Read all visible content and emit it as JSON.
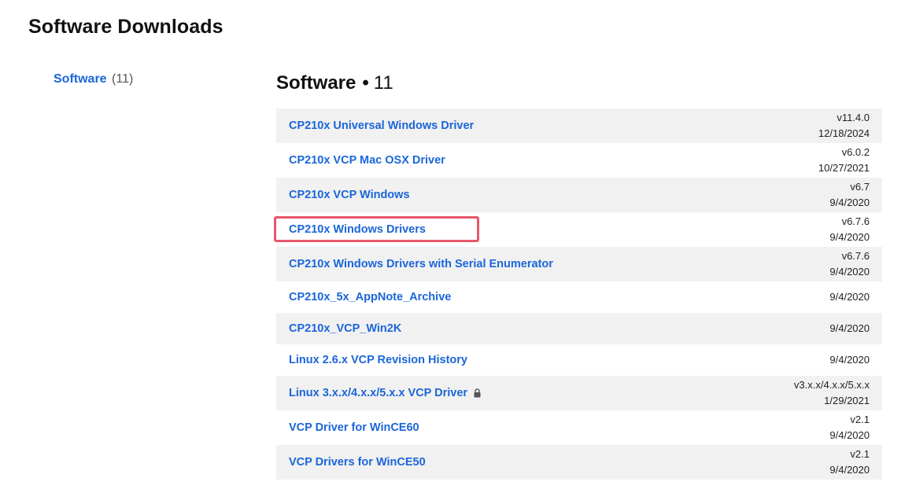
{
  "page": {
    "title": "Software Downloads"
  },
  "sidebar": {
    "items": [
      {
        "label": "Software",
        "count": "(11)"
      }
    ]
  },
  "section": {
    "name": "Software",
    "separator": "•",
    "count": "11"
  },
  "downloads": [
    {
      "name": "CP210x Universal Windows Driver",
      "version": "v11.4.0",
      "date": "12/18/2024",
      "locked": false
    },
    {
      "name": "CP210x VCP Mac OSX Driver",
      "version": "v6.0.2",
      "date": "10/27/2021",
      "locked": false
    },
    {
      "name": "CP210x VCP Windows",
      "version": "v6.7",
      "date": "9/4/2020",
      "locked": false
    },
    {
      "name": "CP210x Windows Drivers",
      "version": "v6.7.6",
      "date": "9/4/2020",
      "locked": false,
      "highlighted": true
    },
    {
      "name": "CP210x Windows Drivers with Serial Enumerator",
      "version": "v6.7.6",
      "date": "9/4/2020",
      "locked": false
    },
    {
      "name": "CP210x_5x_AppNote_Archive",
      "version": "",
      "date": "9/4/2020",
      "locked": false
    },
    {
      "name": "CP210x_VCP_Win2K",
      "version": "",
      "date": "9/4/2020",
      "locked": false
    },
    {
      "name": "Linux 2.6.x VCP Revision History",
      "version": "",
      "date": "9/4/2020",
      "locked": false
    },
    {
      "name": "Linux 3.x.x/4.x.x/5.x.x VCP Driver",
      "version": "v3.x.x/4.x.x/5.x.x",
      "date": "1/29/2021",
      "locked": true
    },
    {
      "name": "VCP Driver for WinCE60",
      "version": "v2.1",
      "date": "9/4/2020",
      "locked": false
    },
    {
      "name": "VCP Drivers for WinCE50",
      "version": "v2.1",
      "date": "9/4/2020",
      "locked": false
    }
  ],
  "icons": {
    "lock": "lock-icon"
  },
  "colors": {
    "link": "#1a66d9",
    "row_shade": "#f1f1f1",
    "highlight": "#e8576a"
  }
}
